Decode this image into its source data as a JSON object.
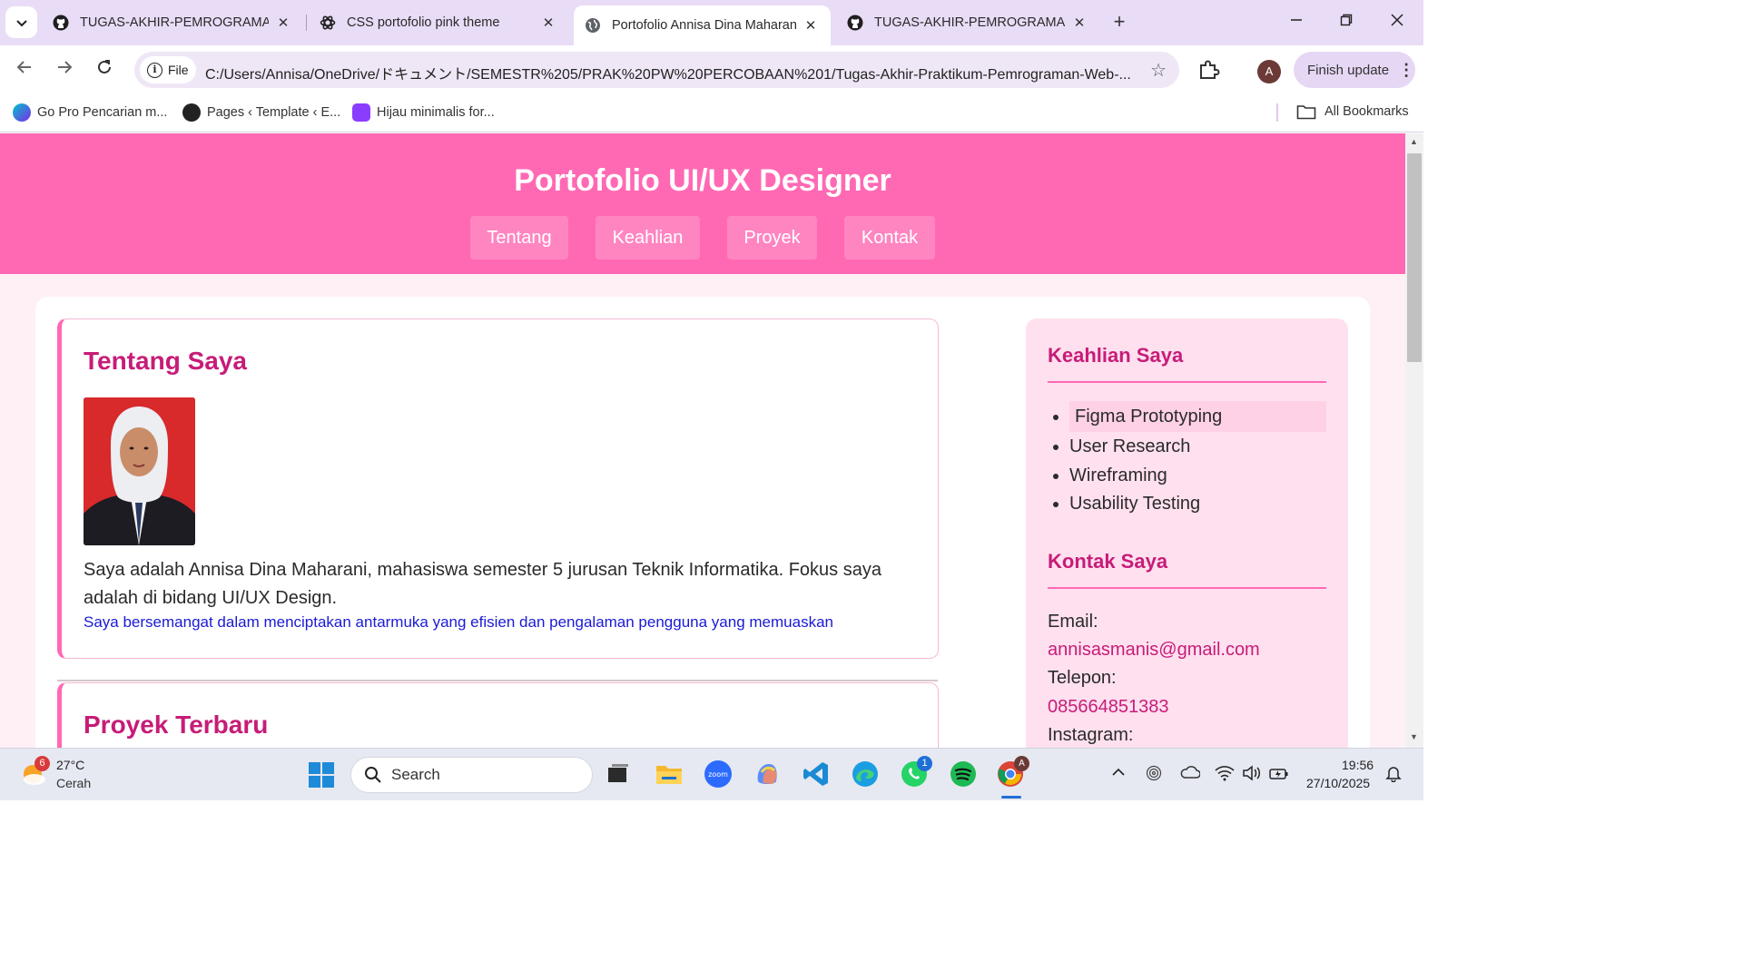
{
  "browser": {
    "tabs": [
      {
        "label": "TUGAS-AKHIR-PEMROGRAMAN",
        "icon": "github-icon"
      },
      {
        "label": "CSS portofolio pink theme",
        "icon": "chatgpt-icon"
      },
      {
        "label": "Portofolio Annisa Dina Maharani",
        "icon": "globe-icon"
      },
      {
        "label": "TUGAS-AKHIR-PEMROGRAMAN",
        "icon": "github-icon"
      }
    ],
    "address": {
      "chip_label": "File",
      "url": "C:/Users/Annisa/OneDrive/ドキュメント/SEMESTR%205/PRAK%20PW%20PERCOBAAN%201/Tugas-Akhir-Praktikum-Pemrograman-Web-..."
    },
    "profile_initial": "A",
    "finish_update_label": "Finish update",
    "bookmarks": [
      {
        "label": "Go Pro Pencarian m..."
      },
      {
        "label": "Pages ‹ Template ‹ E..."
      },
      {
        "label": "Hijau minimalis for..."
      }
    ],
    "all_bookmarks_label": "All Bookmarks"
  },
  "site": {
    "title": "Portofolio UI/UX Designer",
    "nav": [
      "Tentang",
      "Keahlian",
      "Proyek",
      "Kontak"
    ],
    "about": {
      "heading": "Tentang Saya",
      "text": "Saya adalah Annisa Dina Maharani, mahasiswa semester 5 jurusan Teknik Informatika. Fokus saya adalah di bidang UI/UX Design.",
      "highlight": "Saya bersemangat dalam menciptakan antarmuka yang efisien dan pengalaman pengguna yang memuaskan"
    },
    "projects_heading": "Proyek Terbaru",
    "skills": {
      "heading": "Keahlian Saya",
      "items": [
        "Figma Prototyping",
        "User Research",
        "Wireframing",
        "Usability Testing"
      ]
    },
    "contact": {
      "heading": "Kontak Saya",
      "email_label": "Email:",
      "email": "annisasmanis@gmail.com",
      "phone_label": "Telepon:",
      "phone": "085664851383",
      "instagram_label": "Instagram:"
    }
  },
  "taskbar": {
    "weather_badge": "6",
    "temperature": "27°C",
    "weather": "Cerah",
    "search_placeholder": "Search",
    "whatsapp_badge": "1",
    "chrome_badge": "A",
    "time": "19:56",
    "date": "27/10/2025"
  },
  "colors": {
    "header_pink": "#ff69b4",
    "heading_magenta": "#c71c78",
    "sidebar_bg": "#ffe0ef",
    "tabstrip": "#e9dcf6"
  }
}
